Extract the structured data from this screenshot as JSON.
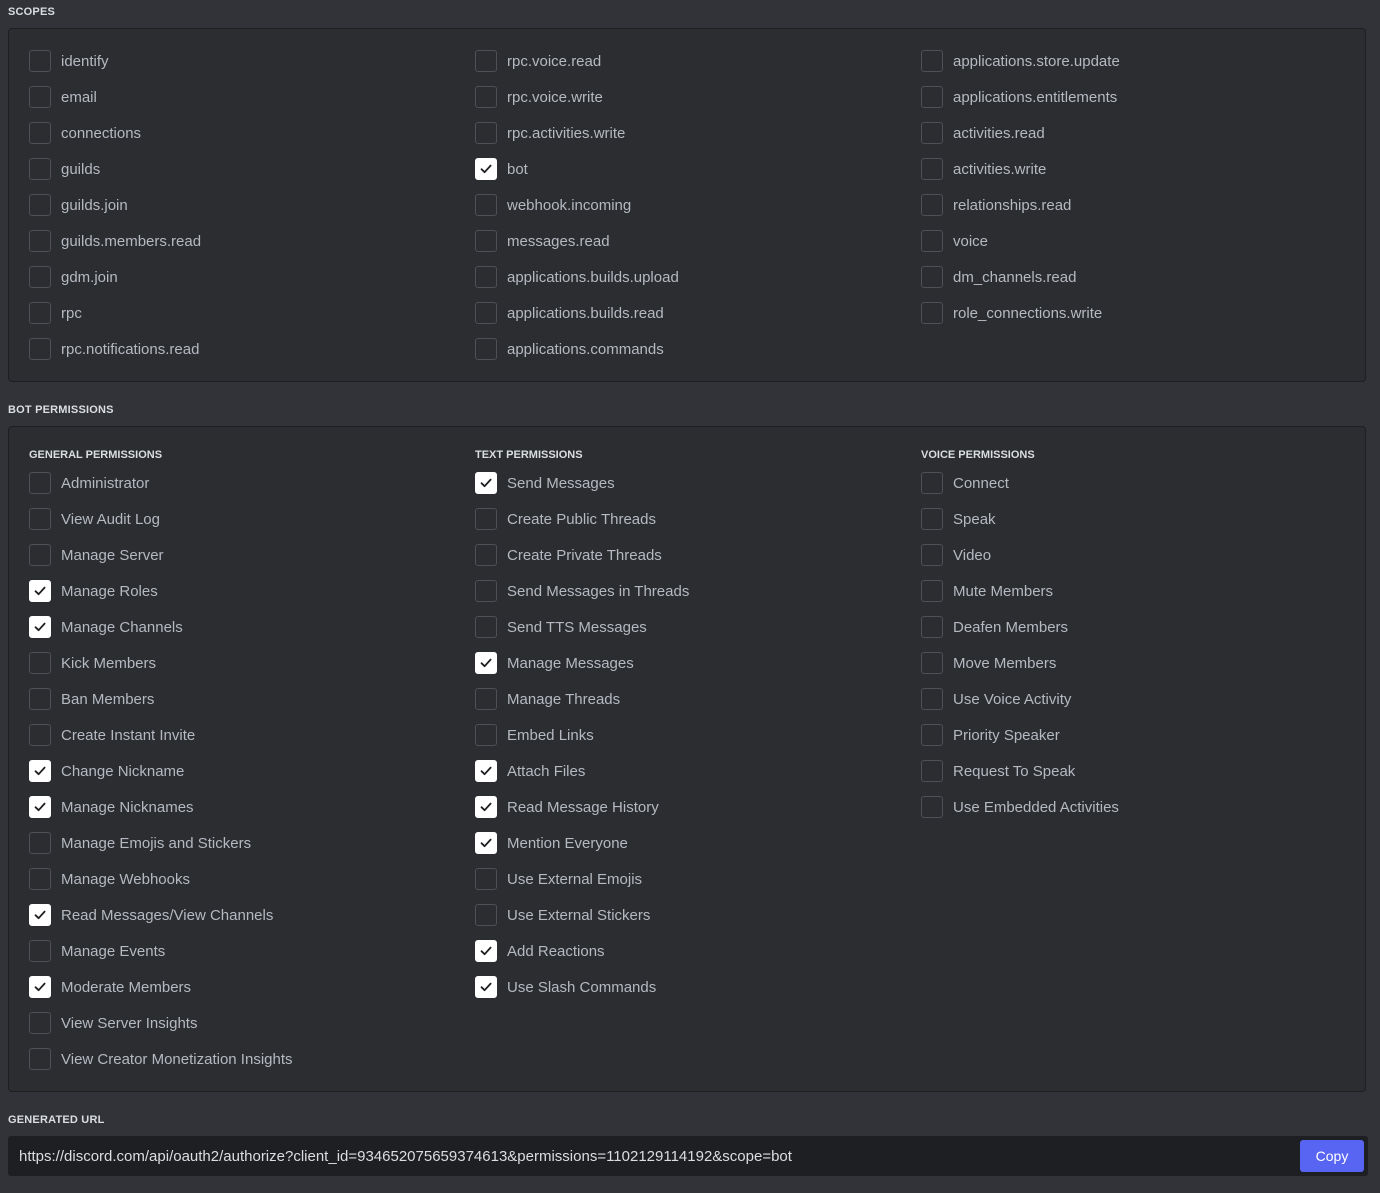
{
  "scopes": {
    "title": "SCOPES",
    "columns": [
      [
        {
          "label": "identify",
          "checked": false
        },
        {
          "label": "email",
          "checked": false
        },
        {
          "label": "connections",
          "checked": false
        },
        {
          "label": "guilds",
          "checked": false
        },
        {
          "label": "guilds.join",
          "checked": false
        },
        {
          "label": "guilds.members.read",
          "checked": false
        },
        {
          "label": "gdm.join",
          "checked": false
        },
        {
          "label": "rpc",
          "checked": false
        },
        {
          "label": "rpc.notifications.read",
          "checked": false
        }
      ],
      [
        {
          "label": "rpc.voice.read",
          "checked": false
        },
        {
          "label": "rpc.voice.write",
          "checked": false
        },
        {
          "label": "rpc.activities.write",
          "checked": false
        },
        {
          "label": "bot",
          "checked": true
        },
        {
          "label": "webhook.incoming",
          "checked": false
        },
        {
          "label": "messages.read",
          "checked": false
        },
        {
          "label": "applications.builds.upload",
          "checked": false
        },
        {
          "label": "applications.builds.read",
          "checked": false
        },
        {
          "label": "applications.commands",
          "checked": false
        }
      ],
      [
        {
          "label": "applications.store.update",
          "checked": false
        },
        {
          "label": "applications.entitlements",
          "checked": false
        },
        {
          "label": "activities.read",
          "checked": false
        },
        {
          "label": "activities.write",
          "checked": false
        },
        {
          "label": "relationships.read",
          "checked": false
        },
        {
          "label": "voice",
          "checked": false
        },
        {
          "label": "dm_channels.read",
          "checked": false
        },
        {
          "label": "role_connections.write",
          "checked": false
        }
      ]
    ]
  },
  "bot_permissions": {
    "title": "BOT PERMISSIONS",
    "groups": [
      {
        "title": "GENERAL PERMISSIONS",
        "items": [
          {
            "label": "Administrator",
            "checked": false
          },
          {
            "label": "View Audit Log",
            "checked": false
          },
          {
            "label": "Manage Server",
            "checked": false
          },
          {
            "label": "Manage Roles",
            "checked": true
          },
          {
            "label": "Manage Channels",
            "checked": true
          },
          {
            "label": "Kick Members",
            "checked": false
          },
          {
            "label": "Ban Members",
            "checked": false
          },
          {
            "label": "Create Instant Invite",
            "checked": false
          },
          {
            "label": "Change Nickname",
            "checked": true
          },
          {
            "label": "Manage Nicknames",
            "checked": true
          },
          {
            "label": "Manage Emojis and Stickers",
            "checked": false
          },
          {
            "label": "Manage Webhooks",
            "checked": false
          },
          {
            "label": "Read Messages/View Channels",
            "checked": true
          },
          {
            "label": "Manage Events",
            "checked": false
          },
          {
            "label": "Moderate Members",
            "checked": true
          },
          {
            "label": "View Server Insights",
            "checked": false
          },
          {
            "label": "View Creator Monetization Insights",
            "checked": false
          }
        ]
      },
      {
        "title": "TEXT PERMISSIONS",
        "items": [
          {
            "label": "Send Messages",
            "checked": true
          },
          {
            "label": "Create Public Threads",
            "checked": false
          },
          {
            "label": "Create Private Threads",
            "checked": false
          },
          {
            "label": "Send Messages in Threads",
            "checked": false
          },
          {
            "label": "Send TTS Messages",
            "checked": false
          },
          {
            "label": "Manage Messages",
            "checked": true
          },
          {
            "label": "Manage Threads",
            "checked": false
          },
          {
            "label": "Embed Links",
            "checked": false
          },
          {
            "label": "Attach Files",
            "checked": true
          },
          {
            "label": "Read Message History",
            "checked": true
          },
          {
            "label": "Mention Everyone",
            "checked": true
          },
          {
            "label": "Use External Emojis",
            "checked": false
          },
          {
            "label": "Use External Stickers",
            "checked": false
          },
          {
            "label": "Add Reactions",
            "checked": true
          },
          {
            "label": "Use Slash Commands",
            "checked": true
          }
        ]
      },
      {
        "title": "VOICE PERMISSIONS",
        "items": [
          {
            "label": "Connect",
            "checked": false
          },
          {
            "label": "Speak",
            "checked": false
          },
          {
            "label": "Video",
            "checked": false
          },
          {
            "label": "Mute Members",
            "checked": false
          },
          {
            "label": "Deafen Members",
            "checked": false
          },
          {
            "label": "Move Members",
            "checked": false
          },
          {
            "label": "Use Voice Activity",
            "checked": false
          },
          {
            "label": "Priority Speaker",
            "checked": false
          },
          {
            "label": "Request To Speak",
            "checked": false
          },
          {
            "label": "Use Embedded Activities",
            "checked": false
          }
        ]
      }
    ]
  },
  "generated_url": {
    "title": "GENERATED URL",
    "url": "https://discord.com/api/oauth2/authorize?client_id=934652075659374613&permissions=1102129114192&scope=bot",
    "copy_label": "Copy"
  },
  "icons": {
    "checkbox_checked": "check-icon"
  },
  "colors": {
    "accent": "#5865f2",
    "background": "#313338",
    "panel": "#2b2d31"
  }
}
